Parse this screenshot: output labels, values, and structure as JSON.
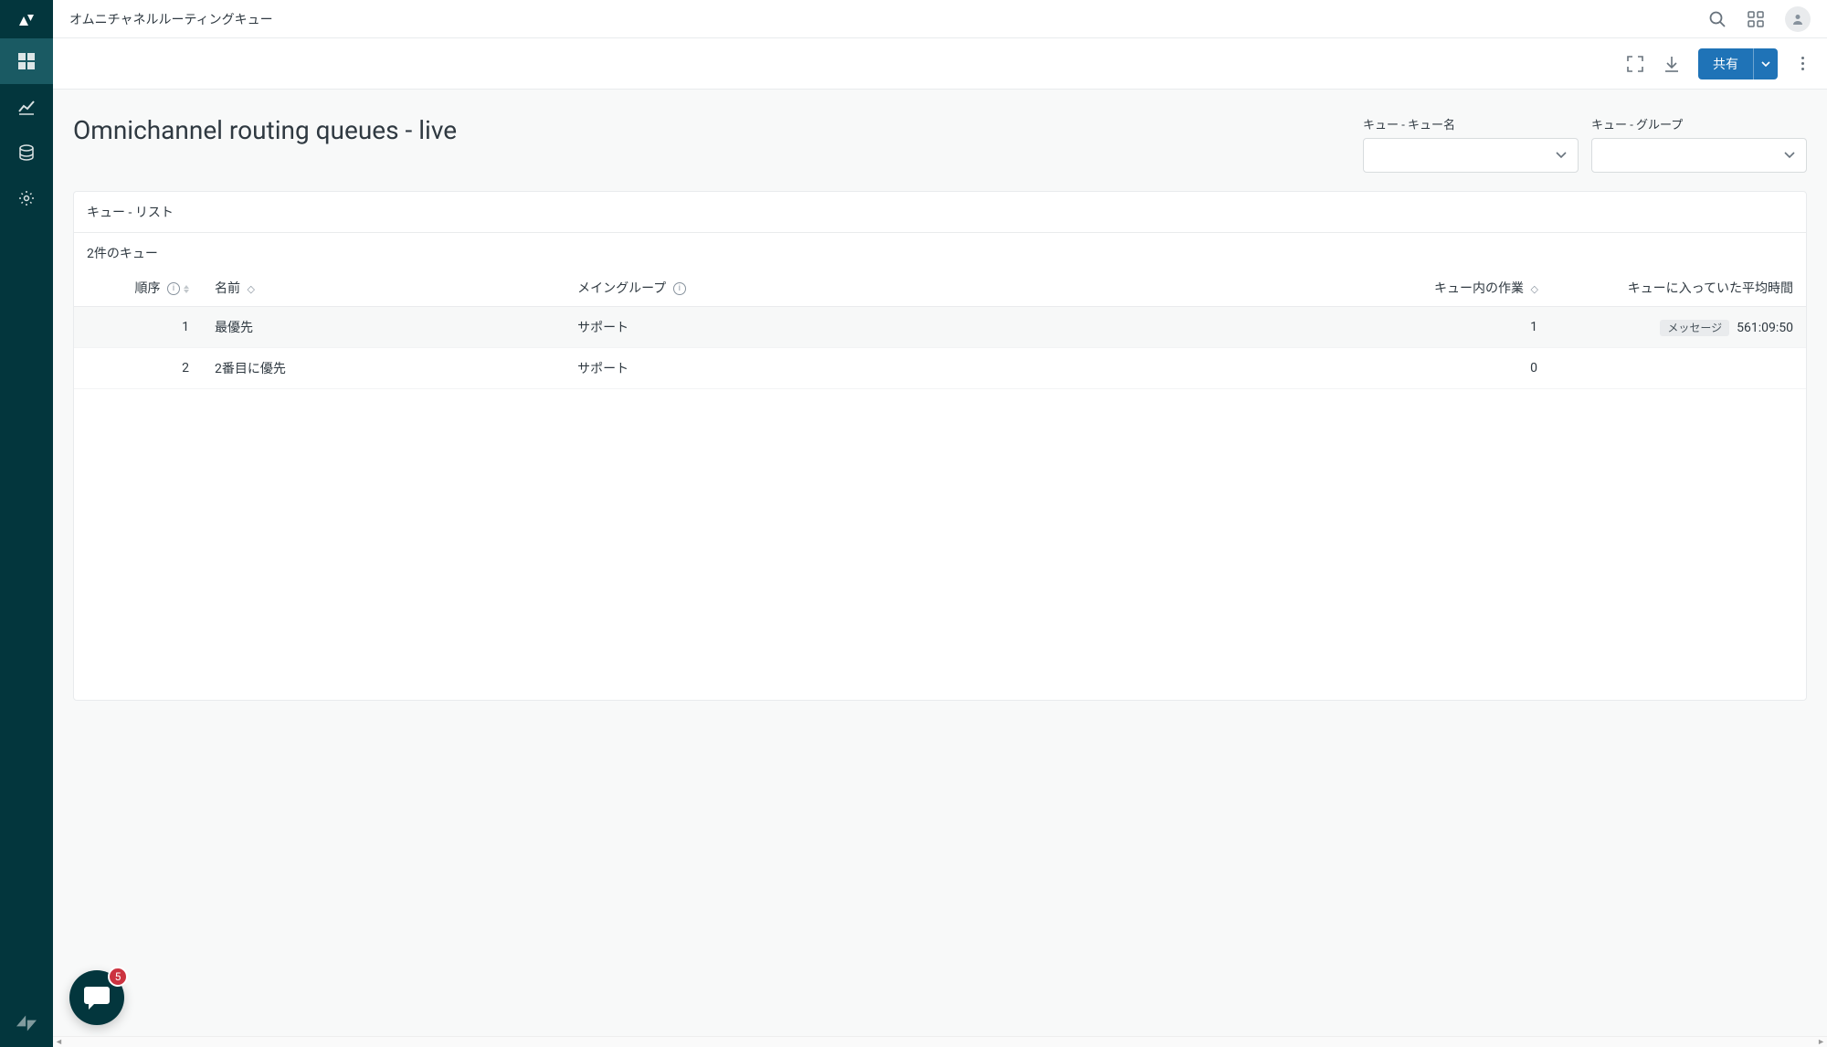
{
  "topbar": {
    "title": "オムニチャネルルーティングキュー"
  },
  "toolbar": {
    "share_label": "共有"
  },
  "page": {
    "title": "Omnichannel routing queues - live"
  },
  "filters": {
    "queue_name_label": "キュー - キュー名",
    "queue_group_label": "キュー - グループ"
  },
  "panel": {
    "header": "キュー - リスト",
    "count_text": "2件のキュー"
  },
  "table": {
    "headers": {
      "order": "順序",
      "name": "名前",
      "main_group": "メイングループ",
      "work_in_queue": "キュー内の作業",
      "avg_time_in_queue": "キューに入っていた平均時間"
    },
    "rows": [
      {
        "order": "1",
        "name": "最優先",
        "main_group": "サポート",
        "work_in_queue": "1",
        "avg_time_badge": "メッセージ",
        "avg_time": "561:09:50"
      },
      {
        "order": "2",
        "name": "2番目に優先",
        "main_group": "サポート",
        "work_in_queue": "0",
        "avg_time_badge": "",
        "avg_time": ""
      }
    ]
  },
  "chat": {
    "badge_count": "5"
  }
}
